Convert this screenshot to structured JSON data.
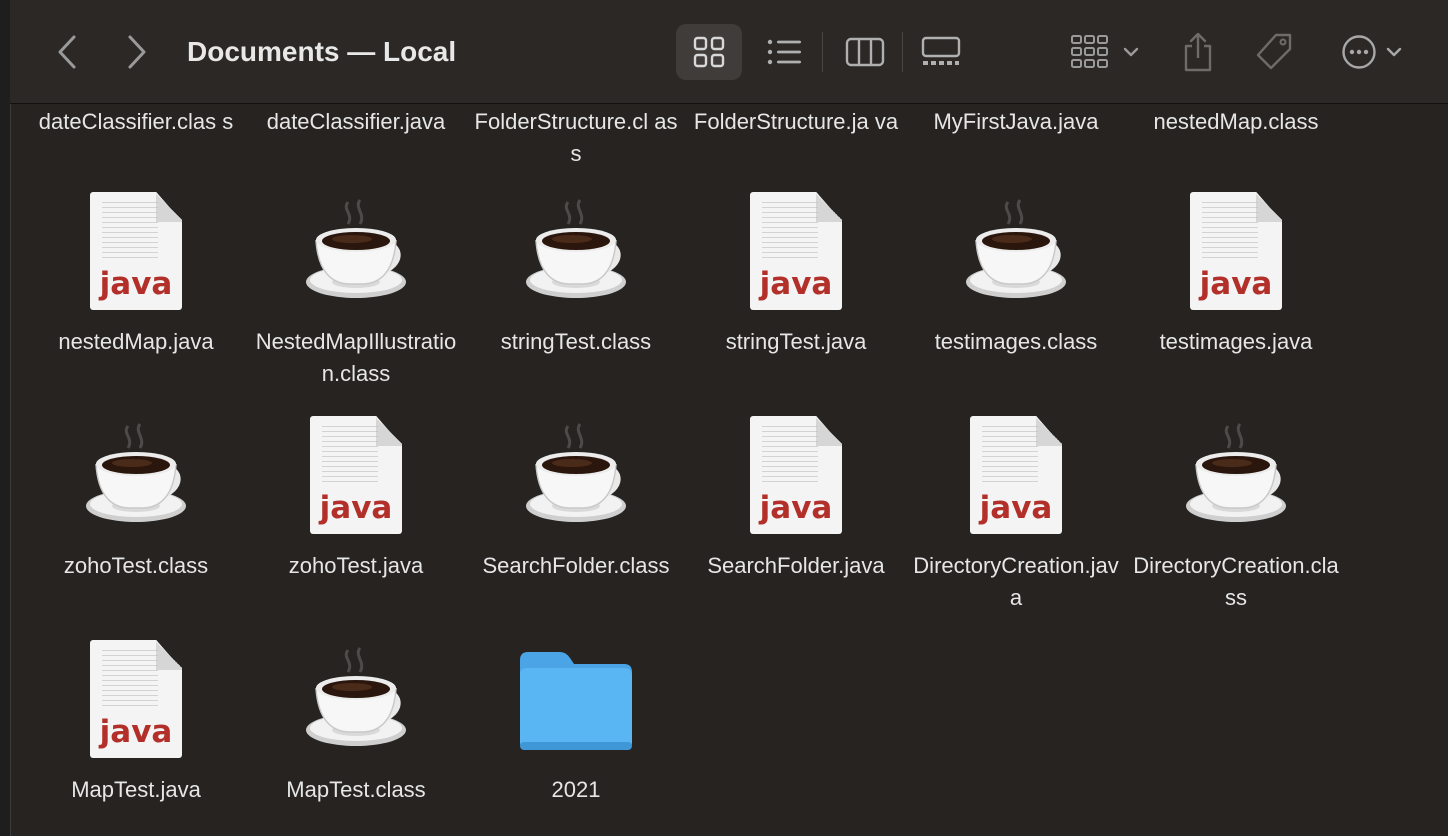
{
  "window": {
    "title": "Documents — Local"
  },
  "toolbar": {
    "back_icon": "chevron-left-icon",
    "forward_icon": "chevron-right-icon",
    "view_modes": [
      "icon-view",
      "list-view",
      "column-view",
      "gallery-view"
    ],
    "selected_view": "icon-view",
    "group_icon": "group-by-icon",
    "share_icon": "share-icon",
    "tag_icon": "tag-icon",
    "more_icon": "ellipsis-circle-icon"
  },
  "top_row_labels": [
    "dateClassifier.clas s",
    "dateClassifier.java",
    "FolderStructure.cl ass",
    "FolderStructure.ja va",
    "MyFirstJava.java",
    "nestedMap.class"
  ],
  "files": [
    {
      "name": "nestedMap.java",
      "kind": "java"
    },
    {
      "name": "NestedMapIllustration.class",
      "kind": "class"
    },
    {
      "name": "stringTest.class",
      "kind": "class"
    },
    {
      "name": "stringTest.java",
      "kind": "java"
    },
    {
      "name": "testimages.class",
      "kind": "class"
    },
    {
      "name": "testimages.java",
      "kind": "java"
    },
    {
      "name": "zohoTest.class",
      "kind": "class"
    },
    {
      "name": "zohoTest.java",
      "kind": "java"
    },
    {
      "name": "SearchFolder.class",
      "kind": "class"
    },
    {
      "name": "SearchFolder.java",
      "kind": "java"
    },
    {
      "name": "DirectoryCreation.java",
      "kind": "java"
    },
    {
      "name": "DirectoryCreation.class",
      "kind": "class"
    },
    {
      "name": "MapTest.java",
      "kind": "java"
    },
    {
      "name": "MapTest.class",
      "kind": "class"
    },
    {
      "name": "2021",
      "kind": "folder"
    }
  ],
  "java_badge": "java",
  "colors": {
    "background": "#262321",
    "toolbar": "#2b2826",
    "folder": "#5ab6f2",
    "java_text": "#b3302a"
  }
}
